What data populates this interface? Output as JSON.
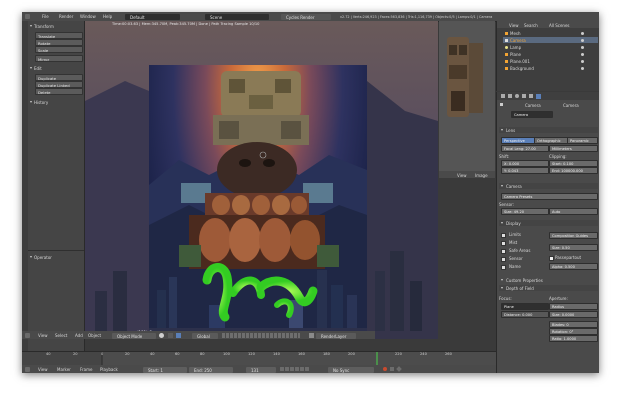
{
  "header": {
    "menu": [
      "File",
      "Render",
      "Window",
      "Help"
    ],
    "screen_value": "Default",
    "scene_value": "Scene",
    "engine_value": "Cycles Render",
    "stats": "v2.72 | Verts:246,923 | Faces:563,836 | Tris:1,116,739 | Objects:0/5 | Lamps:0/1 | Camera"
  },
  "toolshelf": {
    "transform_header": "Transform",
    "transform_buttons": [
      "Translate",
      "Rotate",
      "Scale",
      "Mirror"
    ],
    "edit_header": "Edit",
    "edit_buttons": [
      "Duplicate",
      "Duplicate Linked",
      "Delete"
    ],
    "history_header": "History",
    "operator_header": "Operator"
  },
  "viewport": {
    "hud": "Time:00:03.63 | Mem:345.70M, Peak:345.70M | Done | Path Tracing Sample 10/10",
    "camera_label": "(131) Camera",
    "header_menu": [
      "View",
      "Select",
      "Add",
      "Object"
    ],
    "mode": "Object Mode",
    "pivot": "Global",
    "render_layer": "RenderLayer"
  },
  "thumb": {
    "menu": [
      "View",
      "Image"
    ]
  },
  "outliner": {
    "menu": [
      "View",
      "Search",
      "All Scenes"
    ],
    "items": [
      "Mesh",
      "Camera",
      "Lamp",
      "Plane",
      "Plane.001",
      "Background"
    ]
  },
  "properties": {
    "tabs": [
      "Camera",
      "Camera"
    ],
    "datablock": "Camera",
    "lens_header": "Lens",
    "lens_types": [
      "Perspective",
      "Orthographic",
      "Panoramic"
    ],
    "focal_length": "Focal Leng: 27.00",
    "lens_unit": "Millimeters",
    "shift_label": "Shift:",
    "shift_x": "X: 0.000",
    "shift_y": "Y: 0.043",
    "clipping_label": "Clipping:",
    "clip_start": "Start: 0.100",
    "clip_end": "End: 100000.000",
    "camera_header": "Camera",
    "camera_presets": "Camera Presets",
    "sensor_label": "Sensor:",
    "sensor_size": "Size: 49.20",
    "sensor_fit": "Auto",
    "display_header": "Display",
    "display_left": [
      "Limits",
      "Mist",
      "Safe Areas",
      "Sensor",
      "Name"
    ],
    "composition_guides": "Composition Guides",
    "display_size": "Size: 0.50",
    "passepartout": "Passepartout",
    "alpha": "Alpha: 0.500",
    "custom_props": "Custom Properties",
    "dof_header": "Depth of Field",
    "focus_label": "Focus:",
    "focus_object": "Plane",
    "distance": "Distance: 0.000",
    "aperture_label": "Aperture:",
    "aperture_type": "Radius",
    "aperture_size": "Size: 0.0000",
    "blades": "Blades: 0",
    "rotation": "Rotation: 0°",
    "ratio": "Ratio: 1.0000"
  },
  "timeline": {
    "ticks": [
      "40",
      "20",
      "0",
      "20",
      "40",
      "60",
      "80",
      "100",
      "120",
      "140",
      "160",
      "180",
      "200",
      "220",
      "240",
      "260"
    ],
    "menu": [
      "View",
      "Marker",
      "Frame",
      "Playback"
    ],
    "start": "Start: 1",
    "end": "End: 250",
    "current": "131",
    "sync": "No Sync"
  },
  "colors": {
    "accent_blue": "#5a7fb8",
    "highlight_orange": "#f2a433",
    "playhead_green": "#4ad24a"
  }
}
